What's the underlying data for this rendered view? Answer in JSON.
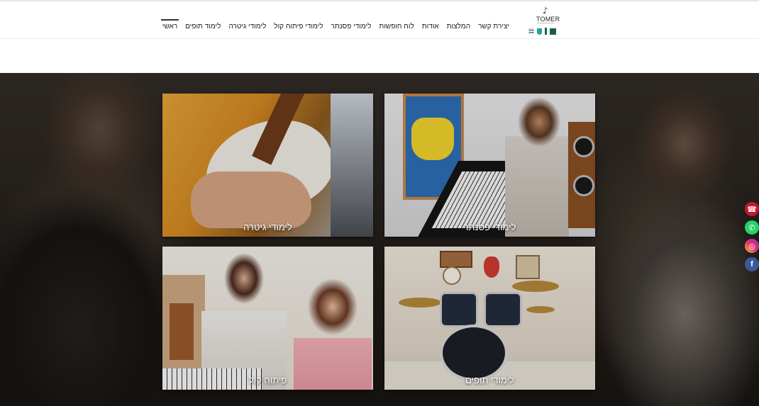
{
  "header": {
    "logo_text": "TOMER",
    "logo_note": "♪",
    "nav": [
      {
        "label": "ראשי",
        "active": true
      },
      {
        "label": "לימוד תופים",
        "active": false
      },
      {
        "label": "לימודי גיטרה",
        "active": false
      },
      {
        "label": "לימודי פיתוח קול",
        "active": false
      },
      {
        "label": "לימודי פסנתר",
        "active": false
      },
      {
        "label": "לוח חופשות",
        "active": false
      },
      {
        "label": "אודות",
        "active": false
      },
      {
        "label": "המלצות",
        "active": false
      },
      {
        "label": "יצירת קשר",
        "active": false
      }
    ]
  },
  "tiles": {
    "guitar": {
      "caption": "לימודי גיטרה"
    },
    "piano": {
      "caption": "לימודי פסנתר"
    },
    "voice": {
      "caption": "פיתוח קול"
    },
    "drums": {
      "caption": "לימודי תופים"
    }
  },
  "social": {
    "phone": "☎",
    "whatsapp": "✆",
    "instagram": "◎",
    "facebook": "f"
  },
  "colors": {
    "phone": "#c6192f",
    "whatsapp": "#25d366",
    "instagram": "#e1306c",
    "facebook": "#3b5998"
  }
}
